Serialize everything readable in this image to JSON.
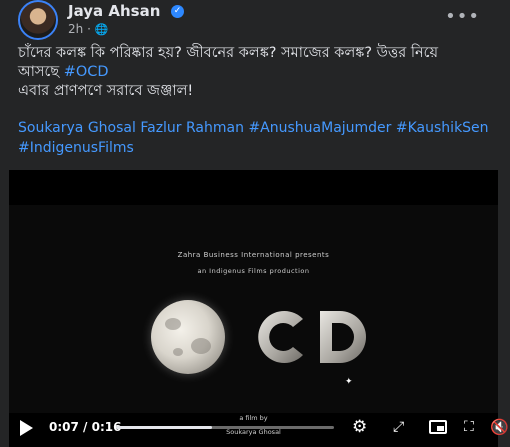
{
  "post": {
    "author": "Jaya Ahsan",
    "time": "2h",
    "privacy_icon": "globe-icon",
    "text_line1": "চাঁদের কলঙ্ক কি পরিষ্কার হয়? জীবনের কলঙ্ক? সমাজের কলঙ্ক? উত্তর নিয়ে",
    "text_line2_prefix": "আসছে ",
    "text_line2_tag": "#OCD",
    "text_line3": "এবার প্রাণপণে সরাবে জঞ্জাল!",
    "mentions": {
      "person1": "Soukarya Ghosal",
      "person2": "Fazlur Rahman",
      "tag1": "#AnushuaMajumder",
      "tag2": "#KaushikSen",
      "tag3": "#IndigenusFilms"
    }
  },
  "video": {
    "credit_line1": "Zahra Business International presents",
    "credit_line2": "an Indigenus Films production",
    "title_c": "C",
    "title_d": "D",
    "film_by": "a film by",
    "director": "Soukarya Ghosal",
    "current_time": "0:07",
    "separator": "/",
    "duration": "0:16",
    "progress": 0.44
  },
  "colors": {
    "link": "#4599ff",
    "background": "#242526"
  }
}
